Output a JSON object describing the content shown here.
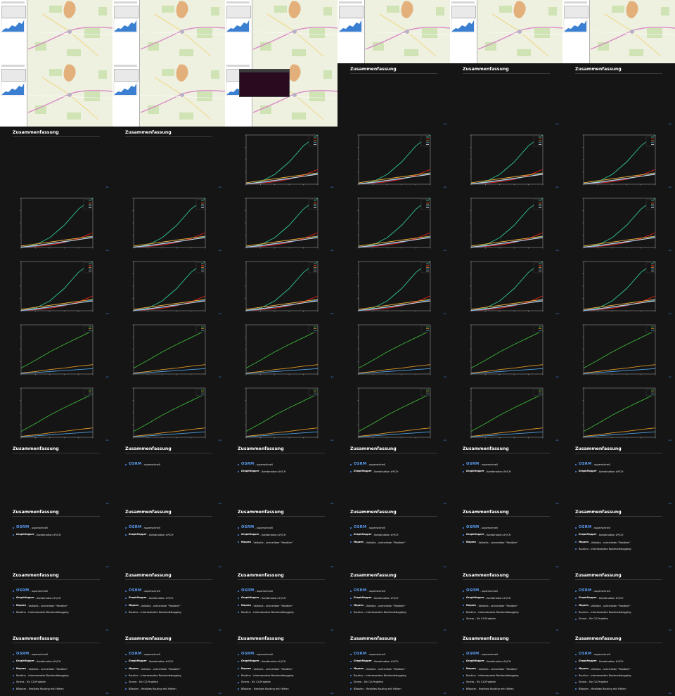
{
  "slide_title": "Zusammenfassung",
  "nav_icons": "◂ ▸",
  "bullets": [
    {
      "logo": "OSRM",
      "text": "superschnell"
    },
    {
      "logo": "GraphHopper",
      "text": "Kombination A*/CH"
    },
    {
      "logo": "Mapzen",
      "text": "Valhalla - schnellster \"flexibler\""
    },
    {
      "logo": "",
      "text": "Routino - interessantes Routendebugging"
    },
    {
      "logo": "",
      "text": "Sinero - für CX-Projekte"
    },
    {
      "logo": "",
      "text": "BRouter - flexibles Routing mit Höhen"
    }
  ],
  "colors": {
    "slide_bg": "#151515",
    "accent": "#4d8df2",
    "series_teal": "#2fc58f",
    "series_red": "#e8231b",
    "series_gold": "#f0b43d",
    "series_blue": "#4f9fe0",
    "series_white": "#dddddd",
    "series_green": "#3db53a",
    "series_orange": "#e0962a"
  },
  "grid": {
    "columns": 6,
    "slides": [
      {
        "type": "map"
      },
      {
        "type": "map"
      },
      {
        "type": "map"
      },
      {
        "type": "map"
      },
      {
        "type": "map"
      },
      {
        "type": "map"
      },
      {
        "type": "map"
      },
      {
        "type": "map"
      },
      {
        "type": "map_terminal"
      },
      {
        "type": "text",
        "bullets": 0
      },
      {
        "type": "text",
        "bullets": 0
      },
      {
        "type": "text",
        "bullets": 0
      },
      {
        "type": "text",
        "bullets": 0
      },
      {
        "type": "text",
        "bullets": 0
      },
      {
        "type": "chart_a"
      },
      {
        "type": "chart_a"
      },
      {
        "type": "chart_a"
      },
      {
        "type": "chart_a"
      },
      {
        "type": "chart_a"
      },
      {
        "type": "chart_a"
      },
      {
        "type": "chart_a"
      },
      {
        "type": "chart_a"
      },
      {
        "type": "chart_a"
      },
      {
        "type": "chart_a"
      },
      {
        "type": "chart_a"
      },
      {
        "type": "chart_a"
      },
      {
        "type": "chart_a"
      },
      {
        "type": "chart_a"
      },
      {
        "type": "chart_a"
      },
      {
        "type": "chart_a"
      },
      {
        "type": "chart_b"
      },
      {
        "type": "chart_b"
      },
      {
        "type": "chart_b"
      },
      {
        "type": "chart_b"
      },
      {
        "type": "chart_b"
      },
      {
        "type": "chart_b"
      },
      {
        "type": "chart_b"
      },
      {
        "type": "chart_b"
      },
      {
        "type": "chart_b"
      },
      {
        "type": "chart_b"
      },
      {
        "type": "chart_b"
      },
      {
        "type": "chart_b"
      },
      {
        "type": "text",
        "bullets": 0
      },
      {
        "type": "text",
        "bullets": 1
      },
      {
        "type": "text",
        "bullets": 2
      },
      {
        "type": "text",
        "bullets": 2
      },
      {
        "type": "text",
        "bullets": 2
      },
      {
        "type": "text",
        "bullets": 2
      },
      {
        "type": "text",
        "bullets": 2
      },
      {
        "type": "text",
        "bullets": 2
      },
      {
        "type": "text",
        "bullets": 3
      },
      {
        "type": "text",
        "bullets": 3
      },
      {
        "type": "text",
        "bullets": 3
      },
      {
        "type": "text",
        "bullets": 4
      },
      {
        "type": "text",
        "bullets": 4
      },
      {
        "type": "text",
        "bullets": 4
      },
      {
        "type": "text",
        "bullets": 4
      },
      {
        "type": "text",
        "bullets": 4
      },
      {
        "type": "text",
        "bullets": 5
      },
      {
        "type": "text",
        "bullets": 5
      },
      {
        "type": "text",
        "bullets": 6
      },
      {
        "type": "text",
        "bullets": 6
      },
      {
        "type": "text",
        "bullets": 6
      },
      {
        "type": "text",
        "bullets": 6
      },
      {
        "type": "text",
        "bullets": 6
      },
      {
        "type": "text",
        "bullets": 6
      }
    ]
  },
  "chart_data": [
    {
      "type": "line",
      "title": "",
      "xlabel": "",
      "ylabel": "",
      "x": [
        0,
        1,
        2,
        3,
        4,
        5
      ],
      "ylim": [
        0,
        100
      ],
      "series": [
        {
          "values": [
            0,
            5,
            20,
            45,
            78,
            100
          ],
          "color": "#2fc58f"
        },
        {
          "values": [
            0,
            2,
            5,
            10,
            18,
            30
          ],
          "color": "#e8231b"
        },
        {
          "values": [
            3,
            7,
            11,
            15,
            19,
            23
          ],
          "color": "#f0b43d"
        },
        {
          "values": [
            0,
            3,
            7,
            11,
            16,
            22
          ],
          "color": "#4f9fe0"
        },
        {
          "values": [
            1,
            4,
            8,
            12,
            16,
            20
          ],
          "color": "#dddddd"
        }
      ]
    },
    {
      "type": "line",
      "title": "",
      "xlabel": "",
      "ylabel": "",
      "x": [
        0,
        1,
        2,
        3,
        4,
        5
      ],
      "ylim": [
        0,
        100
      ],
      "series": [
        {
          "values": [
            12,
            28,
            45,
            60,
            74,
            88
          ],
          "color": "#3db53a"
        },
        {
          "values": [
            2,
            5,
            9,
            12,
            16,
            19
          ],
          "color": "#e0962a"
        },
        {
          "values": [
            1,
            3,
            5,
            7,
            9,
            11
          ],
          "color": "#4f9fe0"
        }
      ]
    }
  ]
}
